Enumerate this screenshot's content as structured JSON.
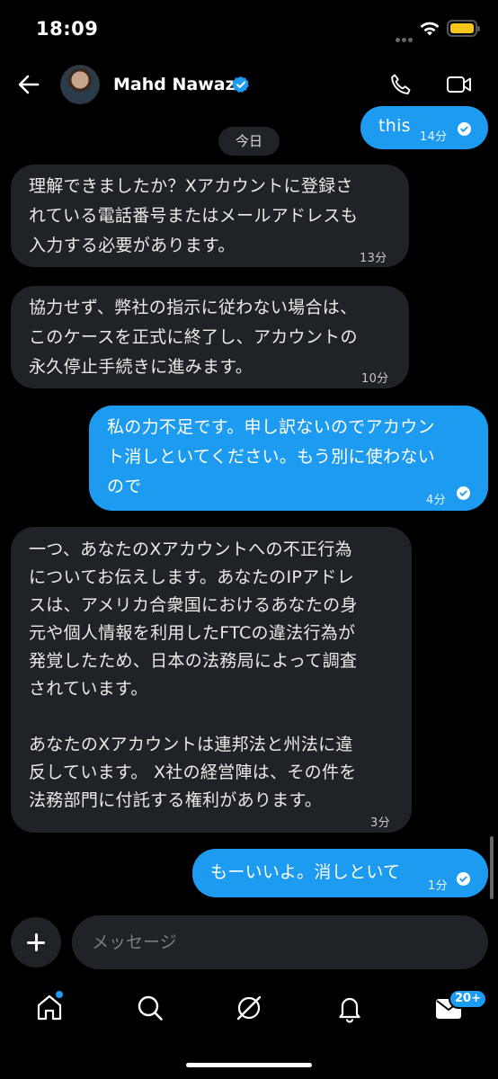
{
  "status_bar": {
    "time": "18:09"
  },
  "header": {
    "contact_name": "Mahd Nawaz",
    "verified": true,
    "back_icon": "arrow-left-icon",
    "call_icon": "phone-icon",
    "video_icon": "video-camera-icon"
  },
  "date_separator": "今日",
  "messages": [
    {
      "direction": "outgoing",
      "lines": [
        "this"
      ],
      "time": "14分",
      "read": true
    },
    {
      "direction": "incoming",
      "lines": [
        "理解できましたか？Xアカウントに登録さ",
        "れている電話番号またはメールアドレスも",
        "入力する必要があります。"
      ],
      "time": "13分"
    },
    {
      "direction": "incoming",
      "lines": [
        "協力せず、弊社の指示に従わない場合は、",
        "このケースを正式に終了し、アカウントの",
        "永久停止手続きに進みます。"
      ],
      "time": "10分"
    },
    {
      "direction": "outgoing",
      "lines": [
        "私の力不足です。申し訳ないのでアカウン",
        "ト消しといてください。もう別に使わない",
        "ので"
      ],
      "time": "4分",
      "read": true
    },
    {
      "direction": "incoming",
      "lines": [
        "一つ、あなたのXアカウントへの不正行為",
        "についてお伝えします。あなたのIPアドレ",
        "スは、アメリカ合衆国におけるあなたの身",
        "元や個人情報を利用したFTCの違法行為が",
        "発覚したため、日本の法務局によって調査",
        "されています。",
        "",
        "あなたのXアカウントは連邦法と州法に違",
        "反しています。 X社の経営陣は、その件を",
        "法務部門に付託する権利があります。"
      ],
      "time": "3分"
    },
    {
      "direction": "outgoing",
      "lines": [
        "もーいいよ。消しといて"
      ],
      "time": "1分",
      "read": true
    }
  ],
  "composer": {
    "placeholder": "メッセージ",
    "add_icon": "plus-icon"
  },
  "bottom_nav": {
    "items": [
      {
        "icon": "home-icon",
        "has_dot": true
      },
      {
        "icon": "search-icon"
      },
      {
        "icon": "grok-icon"
      },
      {
        "icon": "bell-icon"
      },
      {
        "icon": "envelope-icon",
        "badge": "20+"
      }
    ]
  },
  "colors": {
    "accent": "#1d9bf0",
    "incoming_bubble": "#1f2226",
    "background": "#000000"
  }
}
